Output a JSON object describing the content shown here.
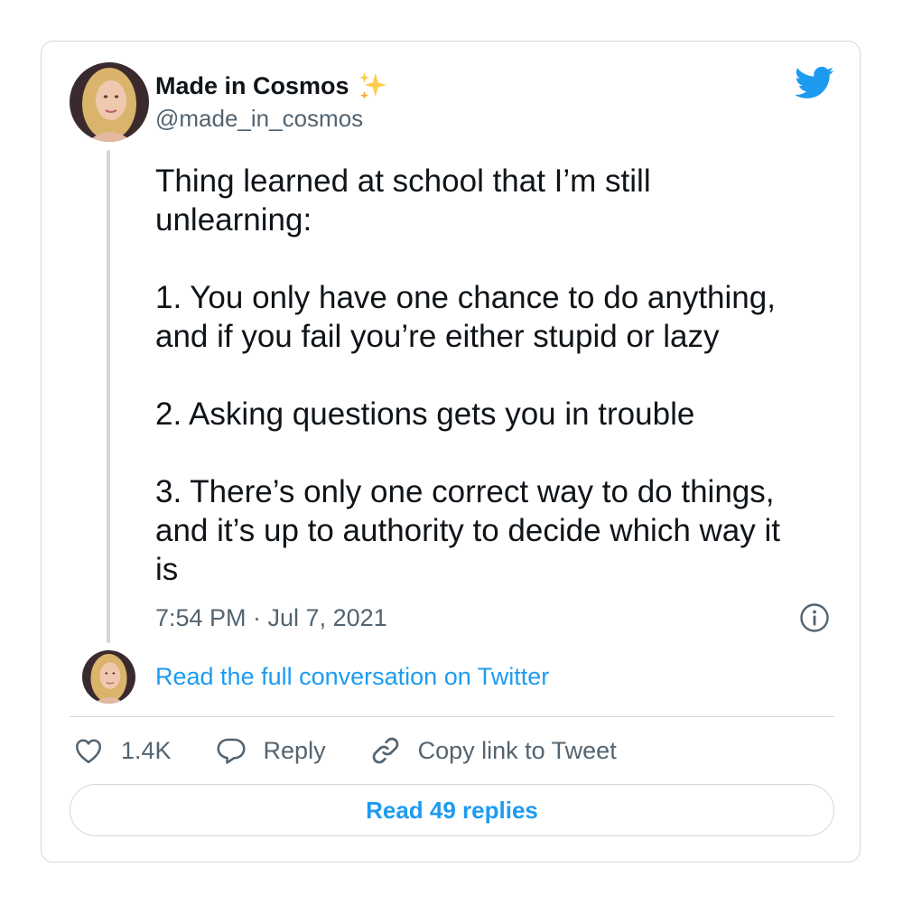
{
  "author": {
    "display_name": "Made in Cosmos",
    "handle": "@made_in_cosmos",
    "name_emoji_icon": "sparkles-icon"
  },
  "tweet": {
    "text": "Thing learned at school that I’m still\nunlearning:\n\n1. You only have one chance to do anything,\nand if you fail you’re either stupid or lazy\n\n2. Asking questions gets you in trouble\n\n3. There’s only one correct way to do things,\nand it’s up to authority to decide which way it\nis",
    "timestamp": "7:54 PM · Jul 7, 2021"
  },
  "conversation": {
    "read_full_label": "Read the full conversation on Twitter"
  },
  "actions": {
    "like_count": "1.4K",
    "reply_label": "Reply",
    "copy_link_label": "Copy link to Tweet"
  },
  "footer": {
    "read_replies_label": "Read 49 replies"
  },
  "colors": {
    "accent": "#1d9bf0",
    "text": "#0f1419",
    "muted": "#536471",
    "border": "#cfd9de"
  },
  "icons": [
    "twitter-logo-icon",
    "info-icon",
    "heart-icon",
    "reply-icon",
    "link-icon",
    "sparkles-icon"
  ]
}
